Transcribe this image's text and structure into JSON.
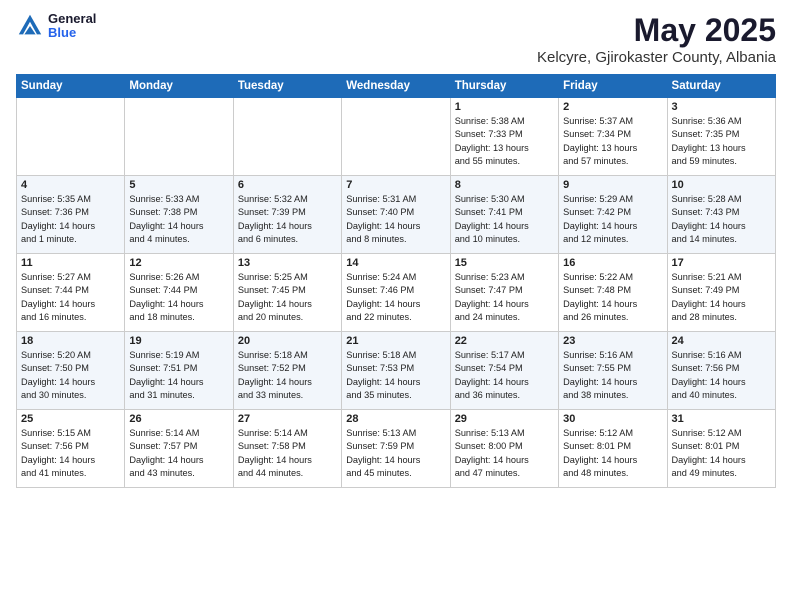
{
  "header": {
    "logo_general": "General",
    "logo_blue": "Blue",
    "month": "May 2025",
    "location": "Kelcyre, Gjirokaster County, Albania"
  },
  "weekdays": [
    "Sunday",
    "Monday",
    "Tuesday",
    "Wednesday",
    "Thursday",
    "Friday",
    "Saturday"
  ],
  "weeks": [
    [
      {
        "day": "",
        "text": ""
      },
      {
        "day": "",
        "text": ""
      },
      {
        "day": "",
        "text": ""
      },
      {
        "day": "",
        "text": ""
      },
      {
        "day": "1",
        "text": "Sunrise: 5:38 AM\nSunset: 7:33 PM\nDaylight: 13 hours\nand 55 minutes."
      },
      {
        "day": "2",
        "text": "Sunrise: 5:37 AM\nSunset: 7:34 PM\nDaylight: 13 hours\nand 57 minutes."
      },
      {
        "day": "3",
        "text": "Sunrise: 5:36 AM\nSunset: 7:35 PM\nDaylight: 13 hours\nand 59 minutes."
      }
    ],
    [
      {
        "day": "4",
        "text": "Sunrise: 5:35 AM\nSunset: 7:36 PM\nDaylight: 14 hours\nand 1 minute."
      },
      {
        "day": "5",
        "text": "Sunrise: 5:33 AM\nSunset: 7:38 PM\nDaylight: 14 hours\nand 4 minutes."
      },
      {
        "day": "6",
        "text": "Sunrise: 5:32 AM\nSunset: 7:39 PM\nDaylight: 14 hours\nand 6 minutes."
      },
      {
        "day": "7",
        "text": "Sunrise: 5:31 AM\nSunset: 7:40 PM\nDaylight: 14 hours\nand 8 minutes."
      },
      {
        "day": "8",
        "text": "Sunrise: 5:30 AM\nSunset: 7:41 PM\nDaylight: 14 hours\nand 10 minutes."
      },
      {
        "day": "9",
        "text": "Sunrise: 5:29 AM\nSunset: 7:42 PM\nDaylight: 14 hours\nand 12 minutes."
      },
      {
        "day": "10",
        "text": "Sunrise: 5:28 AM\nSunset: 7:43 PM\nDaylight: 14 hours\nand 14 minutes."
      }
    ],
    [
      {
        "day": "11",
        "text": "Sunrise: 5:27 AM\nSunset: 7:44 PM\nDaylight: 14 hours\nand 16 minutes."
      },
      {
        "day": "12",
        "text": "Sunrise: 5:26 AM\nSunset: 7:44 PM\nDaylight: 14 hours\nand 18 minutes."
      },
      {
        "day": "13",
        "text": "Sunrise: 5:25 AM\nSunset: 7:45 PM\nDaylight: 14 hours\nand 20 minutes."
      },
      {
        "day": "14",
        "text": "Sunrise: 5:24 AM\nSunset: 7:46 PM\nDaylight: 14 hours\nand 22 minutes."
      },
      {
        "day": "15",
        "text": "Sunrise: 5:23 AM\nSunset: 7:47 PM\nDaylight: 14 hours\nand 24 minutes."
      },
      {
        "day": "16",
        "text": "Sunrise: 5:22 AM\nSunset: 7:48 PM\nDaylight: 14 hours\nand 26 minutes."
      },
      {
        "day": "17",
        "text": "Sunrise: 5:21 AM\nSunset: 7:49 PM\nDaylight: 14 hours\nand 28 minutes."
      }
    ],
    [
      {
        "day": "18",
        "text": "Sunrise: 5:20 AM\nSunset: 7:50 PM\nDaylight: 14 hours\nand 30 minutes."
      },
      {
        "day": "19",
        "text": "Sunrise: 5:19 AM\nSunset: 7:51 PM\nDaylight: 14 hours\nand 31 minutes."
      },
      {
        "day": "20",
        "text": "Sunrise: 5:18 AM\nSunset: 7:52 PM\nDaylight: 14 hours\nand 33 minutes."
      },
      {
        "day": "21",
        "text": "Sunrise: 5:18 AM\nSunset: 7:53 PM\nDaylight: 14 hours\nand 35 minutes."
      },
      {
        "day": "22",
        "text": "Sunrise: 5:17 AM\nSunset: 7:54 PM\nDaylight: 14 hours\nand 36 minutes."
      },
      {
        "day": "23",
        "text": "Sunrise: 5:16 AM\nSunset: 7:55 PM\nDaylight: 14 hours\nand 38 minutes."
      },
      {
        "day": "24",
        "text": "Sunrise: 5:16 AM\nSunset: 7:56 PM\nDaylight: 14 hours\nand 40 minutes."
      }
    ],
    [
      {
        "day": "25",
        "text": "Sunrise: 5:15 AM\nSunset: 7:56 PM\nDaylight: 14 hours\nand 41 minutes."
      },
      {
        "day": "26",
        "text": "Sunrise: 5:14 AM\nSunset: 7:57 PM\nDaylight: 14 hours\nand 43 minutes."
      },
      {
        "day": "27",
        "text": "Sunrise: 5:14 AM\nSunset: 7:58 PM\nDaylight: 14 hours\nand 44 minutes."
      },
      {
        "day": "28",
        "text": "Sunrise: 5:13 AM\nSunset: 7:59 PM\nDaylight: 14 hours\nand 45 minutes."
      },
      {
        "day": "29",
        "text": "Sunrise: 5:13 AM\nSunset: 8:00 PM\nDaylight: 14 hours\nand 47 minutes."
      },
      {
        "day": "30",
        "text": "Sunrise: 5:12 AM\nSunset: 8:01 PM\nDaylight: 14 hours\nand 48 minutes."
      },
      {
        "day": "31",
        "text": "Sunrise: 5:12 AM\nSunset: 8:01 PM\nDaylight: 14 hours\nand 49 minutes."
      }
    ]
  ]
}
